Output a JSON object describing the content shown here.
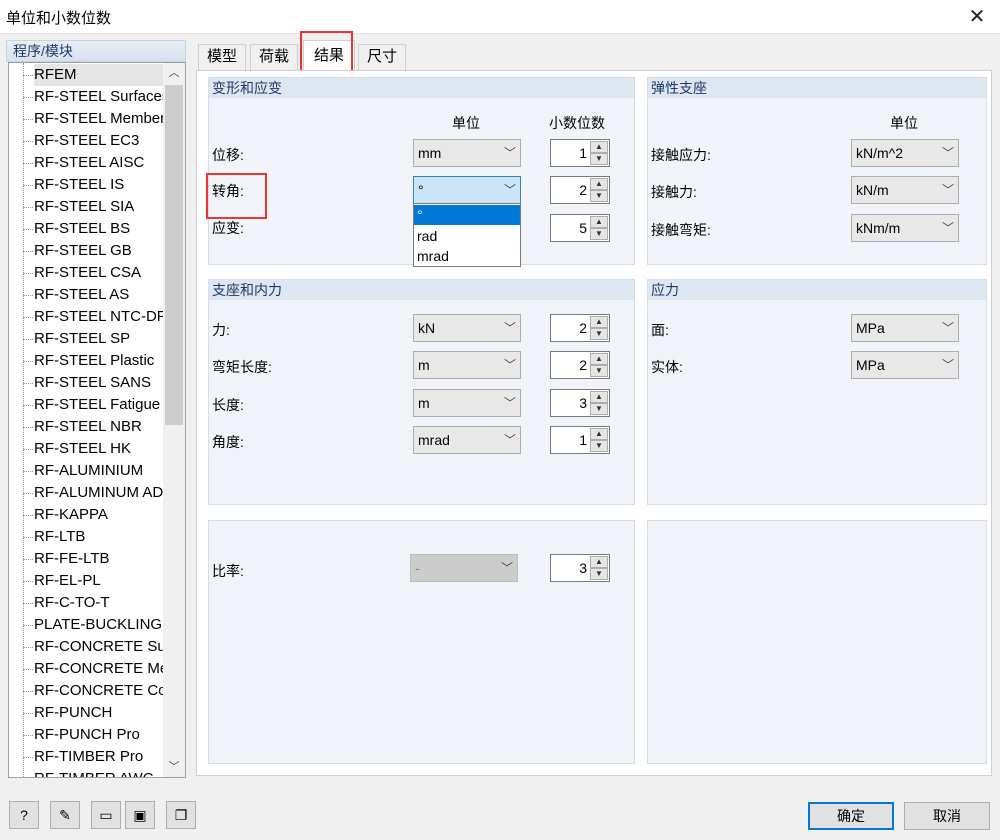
{
  "window": {
    "title": "单位和小数位数",
    "close_glyph": "✕"
  },
  "tree": {
    "header": "程序/模块",
    "items": [
      "RFEM",
      "RF-STEEL Surfaces",
      "RF-STEEL Members",
      "RF-STEEL EC3",
      "RF-STEEL AISC",
      "RF-STEEL IS",
      "RF-STEEL SIA",
      "RF-STEEL BS",
      "RF-STEEL GB",
      "RF-STEEL CSA",
      "RF-STEEL AS",
      "RF-STEEL NTC-DF",
      "RF-STEEL SP",
      "RF-STEEL Plastic",
      "RF-STEEL SANS",
      "RF-STEEL Fatigue Members",
      "RF-STEEL NBR",
      "RF-STEEL HK",
      "RF-ALUMINIUM",
      "RF-ALUMINUM ADM",
      "RF-KAPPA",
      "RF-LTB",
      "RF-FE-LTB",
      "RF-EL-PL",
      "RF-C-TO-T",
      "PLATE-BUCKLING",
      "RF-CONCRETE Surfaces",
      "RF-CONCRETE Members",
      "RF-CONCRETE Columns",
      "RF-PUNCH",
      "RF-PUNCH Pro",
      "RF-TIMBER Pro",
      "RF-TIMBER AWC"
    ]
  },
  "tabs": [
    "模型",
    "荷载",
    "结果",
    "尺寸"
  ],
  "deform": {
    "title": "变形和应变",
    "col_unit": "单位",
    "col_decimals": "小数位数",
    "rows": [
      {
        "label": "位移:",
        "unit": "mm",
        "decimals": "1"
      },
      {
        "label": "转角:",
        "unit": "°",
        "decimals": "2"
      },
      {
        "label": "应变:",
        "unit": "",
        "decimals": "5"
      }
    ],
    "dropdown_options": [
      "°",
      "rad",
      "mrad"
    ]
  },
  "support": {
    "title": "弹性支座",
    "col_unit": "单位",
    "rows": [
      {
        "label": "接触应力:",
        "unit": "kN/m^2"
      },
      {
        "label": "接触力:",
        "unit": "kN/m"
      },
      {
        "label": "接触弯矩:",
        "unit": "kNm/m"
      }
    ]
  },
  "forces": {
    "title": "支座和内力",
    "rows": [
      {
        "label": "力:",
        "unit": "kN",
        "decimals": "2"
      },
      {
        "label": "弯矩长度:",
        "unit": "m",
        "decimals": "2"
      },
      {
        "label": "长度:",
        "unit": "m",
        "decimals": "3"
      },
      {
        "label": "角度:",
        "unit": "mrad",
        "decimals": "1"
      }
    ]
  },
  "stress": {
    "title": "应力",
    "rows": [
      {
        "label": "面:",
        "unit": "MPa"
      },
      {
        "label": "实体:",
        "unit": "MPa"
      }
    ]
  },
  "ratio": {
    "label": "比率:",
    "unit": "-",
    "decimals": "3"
  },
  "footer": {
    "ok": "确定",
    "cancel": "取消"
  },
  "icons": [
    "help-icon",
    "edit-icon",
    "open-folder-icon",
    "save-icon",
    "copy-icon"
  ]
}
